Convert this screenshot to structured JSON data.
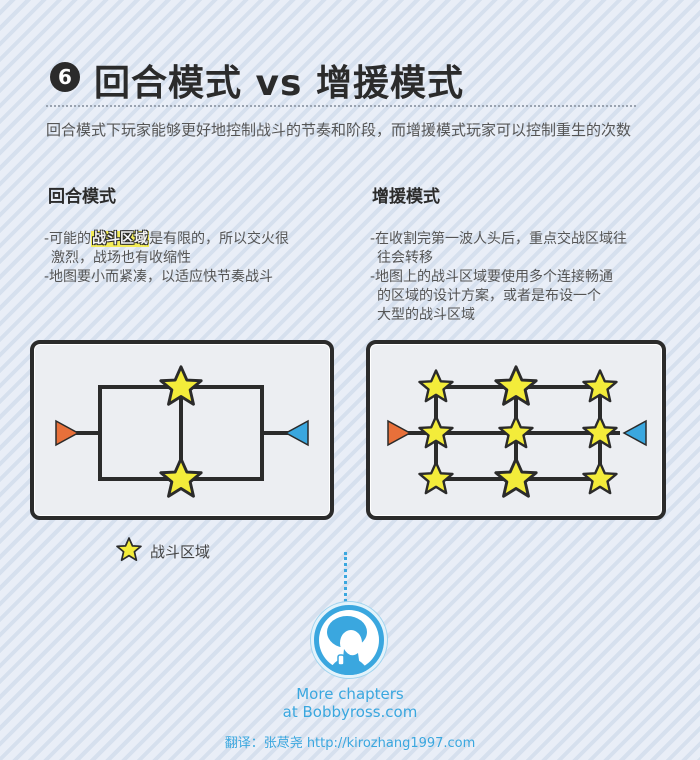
{
  "header": {
    "number": "6",
    "title": "回合模式 vs 增援模式",
    "intro": "回合模式下玩家能够更好地控制战斗的节奏和阶段，而增援模式玩家可以控制重生的次数"
  },
  "left": {
    "heading": "回合模式",
    "bullet1_pre": "-可能的",
    "bullet1_highlight": "战斗区域",
    "bullet1_post": "是有限的，所以交火很",
    "bullet1_cont": "激烈，战场也有收缩性",
    "bullet2": "-地图要小而紧凑，以适应快节奏战斗"
  },
  "right": {
    "heading": "增援模式",
    "bullet1": "-在收割完第一波人头后，重点交战区域往",
    "bullet1_cont": "往会转移",
    "bullet2": "-地图上的战斗区域要使用多个连接畅通",
    "bullet2_cont1": "的区域的设计方案，或者是布设一个",
    "bullet2_cont2": "大型的战斗区域"
  },
  "legend": {
    "label": "战斗区域",
    "icon": "star-icon"
  },
  "footer": {
    "link_line1": "More chapters",
    "link_line2": "at Bobbyross.com",
    "credit": "翻译：张荩尧  http://kirozhang1997.com"
  },
  "colors": {
    "star": "#f3ec3a",
    "spawn_left": "#e8703a",
    "spawn_right": "#3aa7df",
    "accent": "#3aa7df"
  }
}
